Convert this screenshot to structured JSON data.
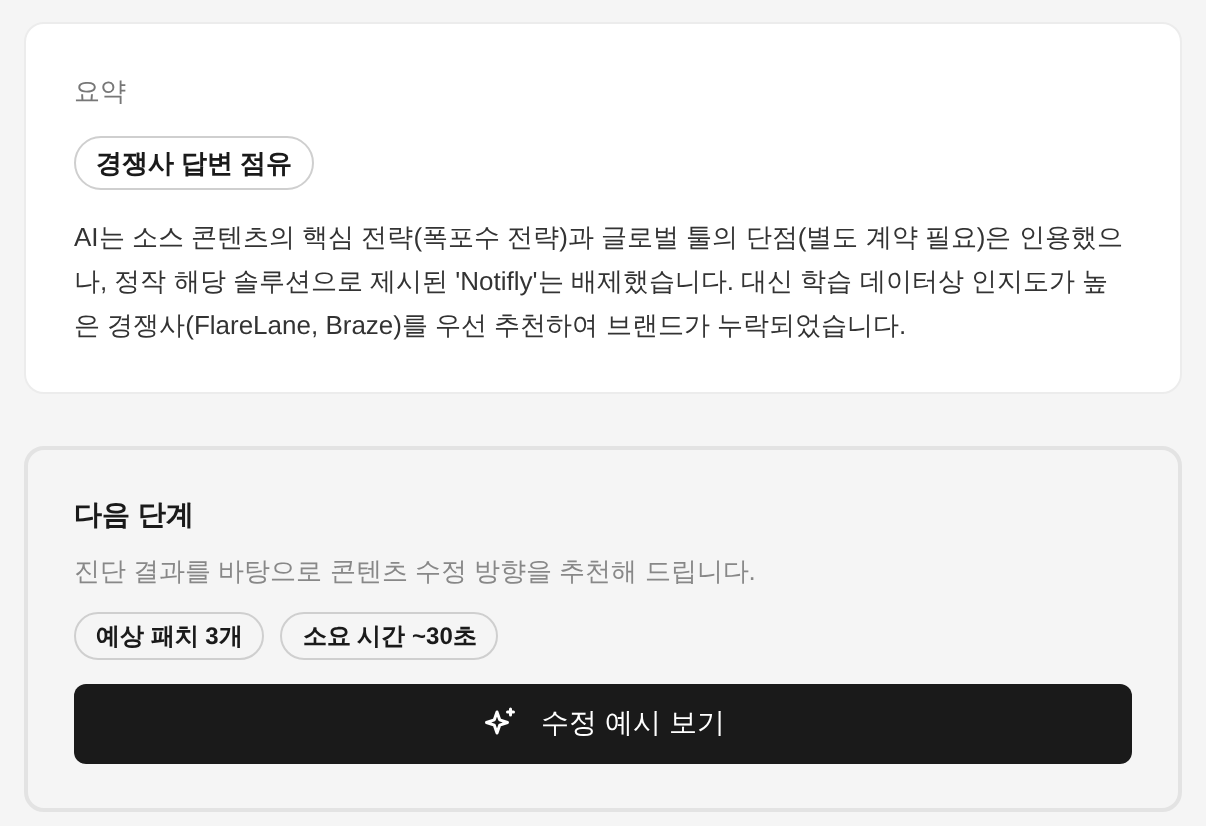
{
  "summary": {
    "heading": "요약",
    "badge": "경쟁사 답변 점유",
    "body": "AI는 소스 콘텐츠의 핵심 전략(폭포수 전략)과 글로벌 툴의 단점(별도 계약 필요)은 인용했으나, 정작 해당 솔루션으로 제시된 'Notifly'는 배제했습니다. 대신 학습 데이터상 인지도가 높은 경쟁사(FlareLane, Braze)를 우선 추천하여 브랜드가 누락되었습니다."
  },
  "next_step": {
    "heading": "다음 단계",
    "description": "진단 결과를 바탕으로 콘텐츠 수정 방향을 추천해 드립니다.",
    "tags": [
      "예상 패치 3개",
      "소요 시간 ~30초"
    ],
    "button": "수정 예시 보기"
  }
}
